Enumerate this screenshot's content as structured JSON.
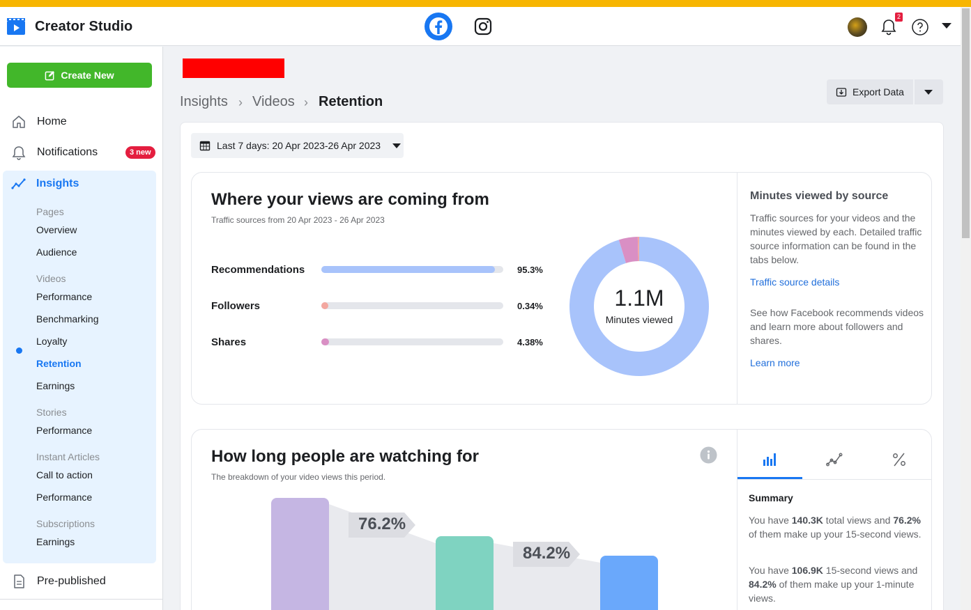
{
  "app": {
    "title": "Creator Studio"
  },
  "header": {
    "notification_count": "2"
  },
  "colors": {
    "accent": "#1877f2",
    "create_green": "#42b72a",
    "stripe": "#f7b500",
    "badge_red": "#e41e3f"
  },
  "sidebar": {
    "create_label": "Create New",
    "home": "Home",
    "notifications": "Notifications",
    "notifications_badge": "3 new",
    "insights": "Insights",
    "groups": [
      {
        "heading": "Pages",
        "items": [
          "Overview",
          "Audience"
        ]
      },
      {
        "heading": "Videos",
        "items": [
          "Performance",
          "Benchmarking",
          "Loyalty",
          "Retention",
          "Earnings"
        ]
      },
      {
        "heading": "Stories",
        "items": [
          "Performance"
        ]
      },
      {
        "heading": "Instant Articles",
        "items": [
          "Call to action",
          "Performance"
        ]
      },
      {
        "heading": "Subscriptions",
        "items": [
          "Earnings"
        ]
      }
    ],
    "active_item": "Retention",
    "pre_published": "Pre-published"
  },
  "breadcrumb": {
    "items": [
      "Insights",
      "Videos",
      "Retention"
    ]
  },
  "toolbar": {
    "export_label": "Export Data"
  },
  "date_range": {
    "label": "Last 7 days: 20 Apr 2023-26 Apr 2023"
  },
  "views_card": {
    "title": "Where your views are coming from",
    "subtitle": "Traffic sources from 20 Apr 2023 - 26 Apr 2023",
    "sources": [
      {
        "label": "Recommendations",
        "value": "95.3%",
        "fraction": 0.953,
        "color": "#a8c3fb"
      },
      {
        "label": "Followers",
        "value": "0.34%",
        "fraction": 0.0034,
        "color": "#f3a7a0"
      },
      {
        "label": "Shares",
        "value": "4.38%",
        "fraction": 0.0438,
        "color": "#d98fc4"
      }
    ],
    "donut_value": "1.1M",
    "donut_caption": "Minutes viewed",
    "side_title": "Minutes viewed by source",
    "side_text1": "Traffic sources for your videos and the minutes viewed by each. Detailed traffic source information can be found in the tabs below.",
    "side_link1": "Traffic source details",
    "side_text2": "See how Facebook recommends videos and learn more about followers and shares.",
    "side_link2": "Learn more"
  },
  "watch_card": {
    "title": "How long people are watching for",
    "subtitle": "The breakdown of your video views this period.",
    "retention_labels": [
      "76.2%",
      "84.2%"
    ],
    "bar_colors": [
      "#c5b6e3",
      "#7fd3c1",
      "#6aa8fb"
    ],
    "summary_title": "Summary",
    "summary1": {
      "pre": "You have ",
      "b1": "140.3K",
      "mid": " total views and ",
      "b2": "76.2%",
      "post": " of them make up your 15-second views."
    },
    "summary2": {
      "pre": "You have ",
      "b1": "106.9K",
      "mid": " 15-second views and ",
      "b2": "84.2%",
      "post": " of them make up your 1-minute views."
    }
  }
}
